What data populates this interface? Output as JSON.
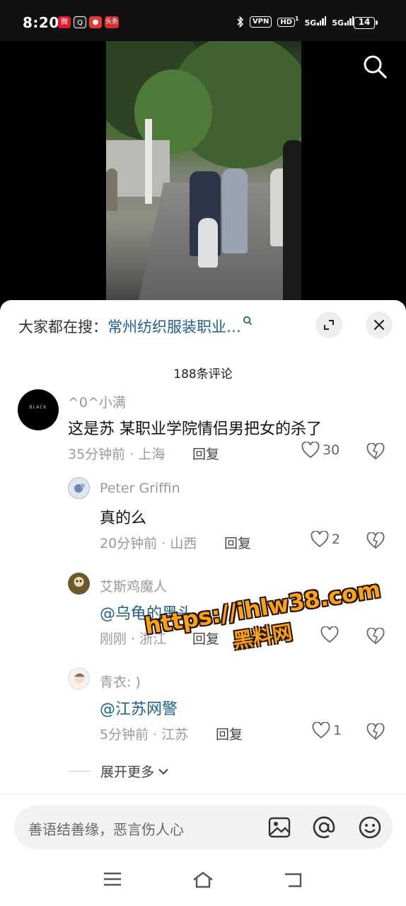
{
  "status_bar": {
    "time": "8:20",
    "apps": [
      {
        "icon": "weibo-icon",
        "color": "#e6162d"
      },
      {
        "icon": "qq-icon",
        "color": "#222222"
      },
      {
        "icon": "location-app-icon",
        "color": "#e53935"
      },
      {
        "icon": "news-icon",
        "color": "#d32f2f",
        "label": "头条"
      }
    ],
    "indicators": {
      "vpn": "VPN",
      "hd": "HD",
      "hd_sub": "1",
      "net1": "5G",
      "net2": "5G"
    },
    "battery": "14"
  },
  "hot_search": {
    "prefix": "大家都在搜：",
    "query": "常州纺织服装职业…"
  },
  "comment_count": "188条评论",
  "comments": [
    {
      "user": "^0^小满",
      "avatar_text": "BLACK",
      "text": "这是苏 某职业学院情侣男把女的杀了",
      "time": "35分钟前",
      "location": "上海",
      "reply": "回复",
      "likes": "30"
    },
    {
      "user": "Peter Griffin",
      "text": "真的么",
      "time": "20分钟前",
      "location": "山西",
      "reply": "回复",
      "likes": "2"
    },
    {
      "user": "艾斯鸡魔人",
      "text": "@乌龟的黑头",
      "time": "刚刚",
      "location": "浙江",
      "reply": "回复",
      "likes": ""
    },
    {
      "user": "青衣: )",
      "text": "@江苏网警",
      "time": "5分钟前",
      "location": "江苏",
      "reply": "回复",
      "likes": "1"
    }
  ],
  "meta_separator": " · ",
  "expand_more": "展开更多",
  "input": {
    "placeholder": "善语结善缘，恶言伤人心"
  },
  "watermark": {
    "url": "https://ihlw38.com",
    "name": "黑料网"
  },
  "colors": {
    "link": "#1f5f8b",
    "watermark": "#f7a21a"
  }
}
